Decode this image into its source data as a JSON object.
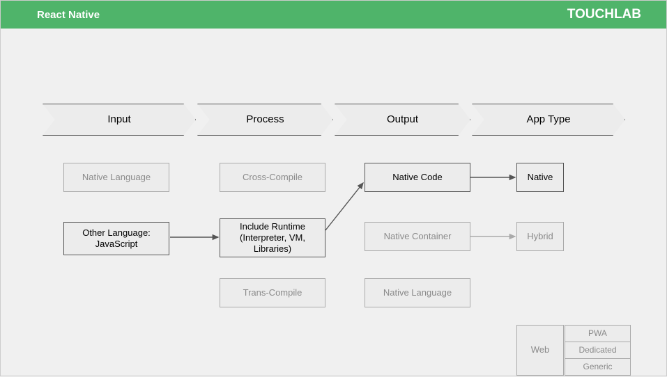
{
  "header": {
    "title": "React Native",
    "brand": "TOUCHLAB"
  },
  "stages": {
    "input": "Input",
    "process": "Process",
    "output": "Output",
    "apptype": "App Type"
  },
  "nodes": {
    "native_language": "Native Language",
    "other_language": "Other Language:\nJavaScript",
    "cross_compile": "Cross-Compile",
    "include_runtime": "Include Runtime\n(Interpreter, VM,\nLibraries)",
    "trans_compile": "Trans-Compile",
    "native_code": "Native Code",
    "native_container": "Native Container",
    "native_language2": "Native Language",
    "native": "Native",
    "hybrid": "Hybrid",
    "web": "Web",
    "pwa": "PWA",
    "dedicated": "Dedicated",
    "generic": "Generic"
  },
  "chart_data": {
    "type": "flow",
    "title": "React Native",
    "stages": [
      "Input",
      "Process",
      "Output",
      "App Type"
    ],
    "nodes": [
      {
        "id": "native_language",
        "stage": "Input",
        "label": "Native Language",
        "active": false
      },
      {
        "id": "other_language",
        "stage": "Input",
        "label": "Other Language: JavaScript",
        "active": true
      },
      {
        "id": "cross_compile",
        "stage": "Process",
        "label": "Cross-Compile",
        "active": false
      },
      {
        "id": "include_runtime",
        "stage": "Process",
        "label": "Include Runtime (Interpreter, VM, Libraries)",
        "active": true
      },
      {
        "id": "trans_compile",
        "stage": "Process",
        "label": "Trans-Compile",
        "active": false
      },
      {
        "id": "native_code",
        "stage": "Output",
        "label": "Native Code",
        "active": true
      },
      {
        "id": "native_container",
        "stage": "Output",
        "label": "Native Container",
        "active": false
      },
      {
        "id": "native_language2",
        "stage": "Output",
        "label": "Native Language",
        "active": false
      },
      {
        "id": "native",
        "stage": "App Type",
        "label": "Native",
        "active": true
      },
      {
        "id": "hybrid",
        "stage": "App Type",
        "label": "Hybrid",
        "active": false
      },
      {
        "id": "web",
        "stage": "App Type",
        "label": "Web",
        "active": false
      },
      {
        "id": "pwa",
        "stage": "App Type",
        "label": "PWA",
        "active": false
      },
      {
        "id": "dedicated",
        "stage": "App Type",
        "label": "Dedicated",
        "active": false
      },
      {
        "id": "generic",
        "stage": "App Type",
        "label": "Generic",
        "active": false
      }
    ],
    "edges": [
      {
        "from": "other_language",
        "to": "include_runtime",
        "active": true
      },
      {
        "from": "include_runtime",
        "to": "native_code",
        "active": true
      },
      {
        "from": "native_code",
        "to": "native",
        "active": true
      },
      {
        "from": "native_container",
        "to": "hybrid",
        "active": false
      }
    ]
  },
  "colors": {
    "header_bg": "#4fb46a",
    "box_bg": "#ececec",
    "active_stroke": "#555555",
    "muted_stroke": "#aaaaaa",
    "muted_text": "#8a8a8a"
  }
}
